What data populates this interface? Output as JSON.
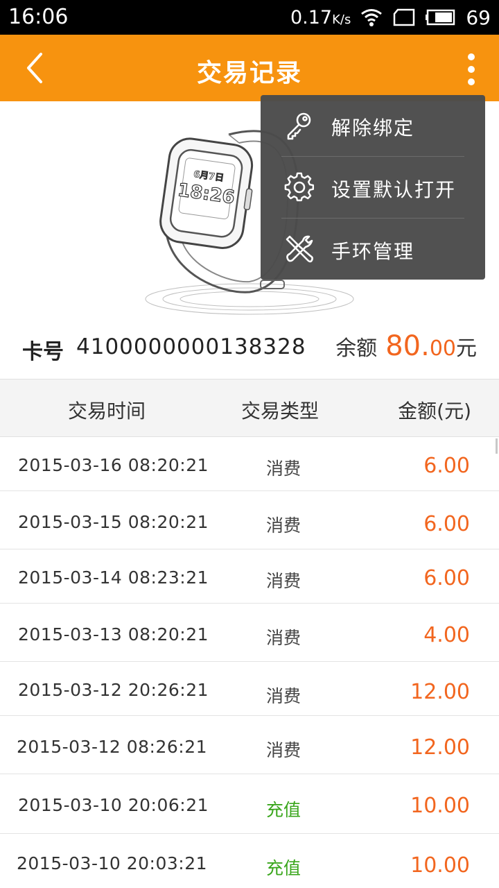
{
  "status_bar": {
    "time": "16:06",
    "net_speed": "0.17",
    "net_speed_unit": "K/s",
    "battery": "69"
  },
  "app_bar": {
    "title": "交易记录",
    "color": "#f7930f"
  },
  "menu": {
    "items": [
      {
        "label": "解除绑定",
        "icon": "key-icon"
      },
      {
        "label": "设置默认打开",
        "icon": "gear-icon"
      },
      {
        "label": "手环管理",
        "icon": "tools-icon"
      }
    ]
  },
  "device_display": {
    "date": "6月7日",
    "time": "18:26"
  },
  "card": {
    "label": "卡号",
    "number": "4100000000138328",
    "balance_label": "余额",
    "balance_int": "80.",
    "balance_dec": "00",
    "balance_unit": "元"
  },
  "table": {
    "headers": [
      "交易时间",
      "交易类型",
      "金额(元)"
    ],
    "rows": [
      {
        "time": "2015-03-16 08:20:21",
        "type": "消费",
        "amount": "6.00",
        "kind": "consume"
      },
      {
        "time": "2015-03-15 08:20:21",
        "type": "消费",
        "amount": "6.00",
        "kind": "consume"
      },
      {
        "time": "2015-03-14 08:23:21",
        "type": "消费",
        "amount": "6.00",
        "kind": "consume"
      },
      {
        "time": "2015-03-13 08:20:21",
        "type": "消费",
        "amount": "4.00",
        "kind": "consume"
      },
      {
        "time": "2015-03-12 20:26:21",
        "type": "消费",
        "amount": "12.00",
        "kind": "consume"
      },
      {
        "time": "2015-03-12 08:26:21",
        "type": "消费",
        "amount": "12.00",
        "kind": "consume"
      },
      {
        "time": "2015-03-10 20:06:21",
        "type": "充值",
        "amount": "10.00",
        "kind": "recharge"
      },
      {
        "time": "2015-03-10 20:03:21",
        "type": "充值",
        "amount": "10.00",
        "kind": "recharge"
      }
    ]
  },
  "colors": {
    "accent": "#f7930f",
    "amount": "#f2661f",
    "recharge": "#3aa61c"
  }
}
